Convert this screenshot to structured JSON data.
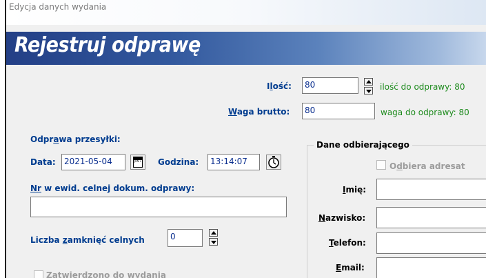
{
  "window": {
    "title": "Edycja danych wydania"
  },
  "banner": {
    "title": "Rejestruj odprawę"
  },
  "quantity": {
    "label_pre": "I",
    "label_u": "l",
    "label_post": "ość:",
    "value": "80",
    "remaining": "ilość do odprawy: 80"
  },
  "weight": {
    "label_u": "W",
    "label_post": "aga brutto:",
    "value": "80",
    "remaining": "waga do odprawy: 80"
  },
  "shipment": {
    "section_pre": "Odpr",
    "section_u": "a",
    "section_post": "wa przesyłki:",
    "date_label": "Data:",
    "date_value": "2021-05-04",
    "time_label": "Godzina:",
    "time_value": "13:14:07"
  },
  "customs_doc": {
    "label_u": "Nr",
    "label_post": " w ewid. celnej dokum. odprawy:",
    "value": ""
  },
  "seals": {
    "label_pre": "Liczba ",
    "label_u": "z",
    "label_post": "amknięć celnych",
    "value": "0"
  },
  "approved": {
    "label": "Zatwierdzono do wydania"
  },
  "recipient": {
    "title": "Dane odbierającego",
    "addressee_pre": "O",
    "addressee_u": "d",
    "addressee_post": "biera adresat",
    "first_name": {
      "label_u": "I",
      "label_post": "mię:",
      "value": ""
    },
    "last_name": {
      "label_u": "N",
      "label_post": "azwisko:",
      "value": ""
    },
    "phone": {
      "label_u": "T",
      "label_post": "elefon:",
      "value": ""
    },
    "email": {
      "label_u": "E",
      "label_post": "mail:",
      "value": ""
    }
  },
  "calendar_icon_text": "JAN 1"
}
